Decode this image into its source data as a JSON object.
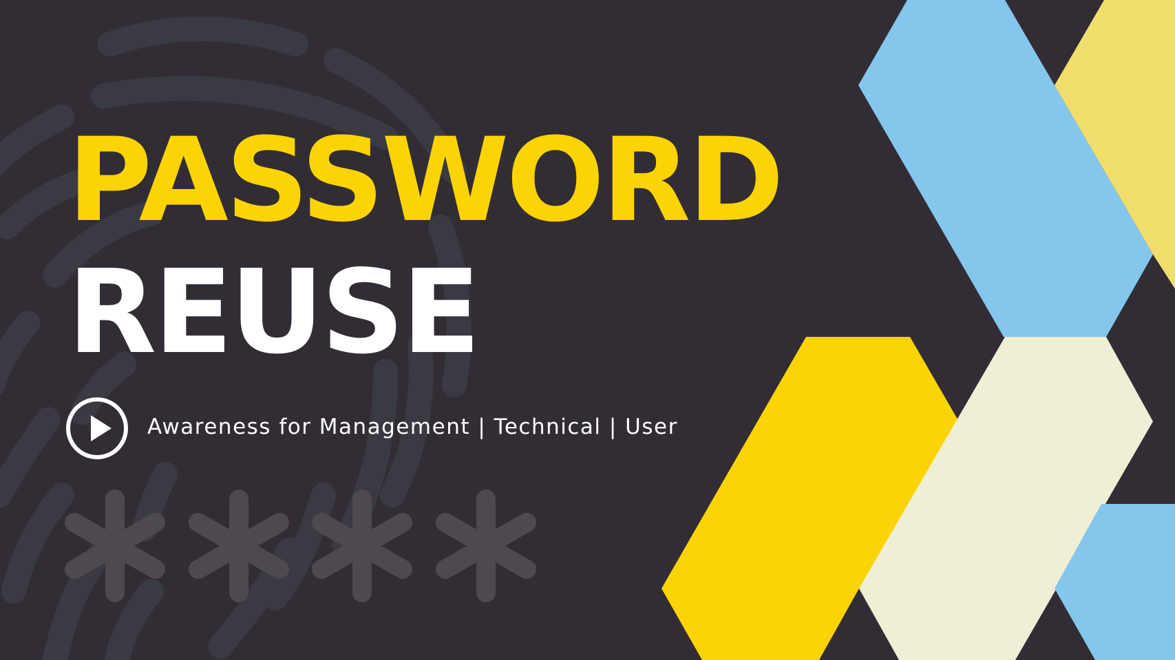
{
  "slide": {
    "title_line_1": "PASSWORD",
    "title_line_2": "REUSE",
    "subtitle": "Awareness for Management | Technical | User"
  },
  "icons": {
    "play": "play-circle-icon",
    "fingerprint": "fingerprint-icon",
    "asterisks": "asterisk-icon"
  },
  "colors": {
    "background": "#322d34",
    "title_accent": "#fcd404",
    "title_secondary": "#ffffff",
    "hex_blue": "#85c6ec",
    "hex_yellow_light": "#f1de6d",
    "hex_yellow": "#fcd404",
    "hex_cream": "#efefd6",
    "fingerprint": "#3a3b42",
    "asterisk": "#4d494e"
  }
}
